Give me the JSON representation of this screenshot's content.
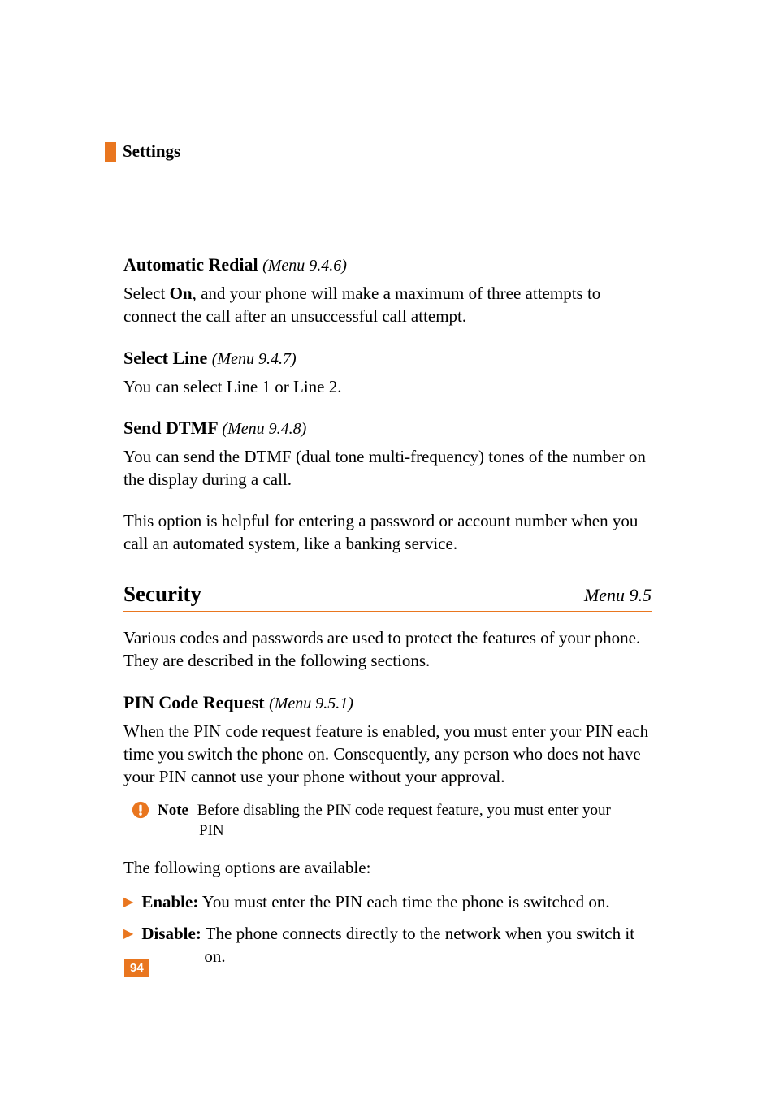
{
  "header": {
    "section_label": "Settings"
  },
  "s1": {
    "title": "Automatic Redial",
    "menu": "(Menu 9.4.6)",
    "p1a": "Select ",
    "p1b": "On",
    "p1c": ", and your phone will make a maximum of three attempts to connect the call after an unsuccessful call attempt."
  },
  "s2": {
    "title": "Select Line",
    "menu": "(Menu 9.4.7)",
    "p1": "You can select Line 1 or Line 2."
  },
  "s3": {
    "title": "Send DTMF",
    "menu": "(Menu 9.4.8)",
    "p1": "You can send the DTMF (dual tone multi-frequency) tones of the number on the display during a call.",
    "p2": "This option is helpful for entering a password or account number when you call an automated system, like a banking service."
  },
  "sec": {
    "title": "Security",
    "menu": "Menu 9.5",
    "p1": "Various codes and passwords are used to protect the features of your phone. They are described in the following sections."
  },
  "s4": {
    "title": "PIN Code Request",
    "menu": "(Menu 9.5.1)",
    "p1": "When the PIN code request feature is enabled, you must enter your PIN each time you switch the phone on. Consequently, any person who does not have your PIN cannot use your phone without your approval.",
    "note_label": "Note",
    "note_text": "Before disabling the PIN code request feature, you must enter your",
    "note_text2": "PIN",
    "p2": "The following options are available:",
    "b1_label": "Enable:",
    "b1_text": " You must enter the PIN each time the phone is switched on.",
    "b2_label": "Disable:",
    "b2_text": " The phone connects directly to the network when you switch it",
    "b2_text2": "on."
  },
  "page_number": "94"
}
